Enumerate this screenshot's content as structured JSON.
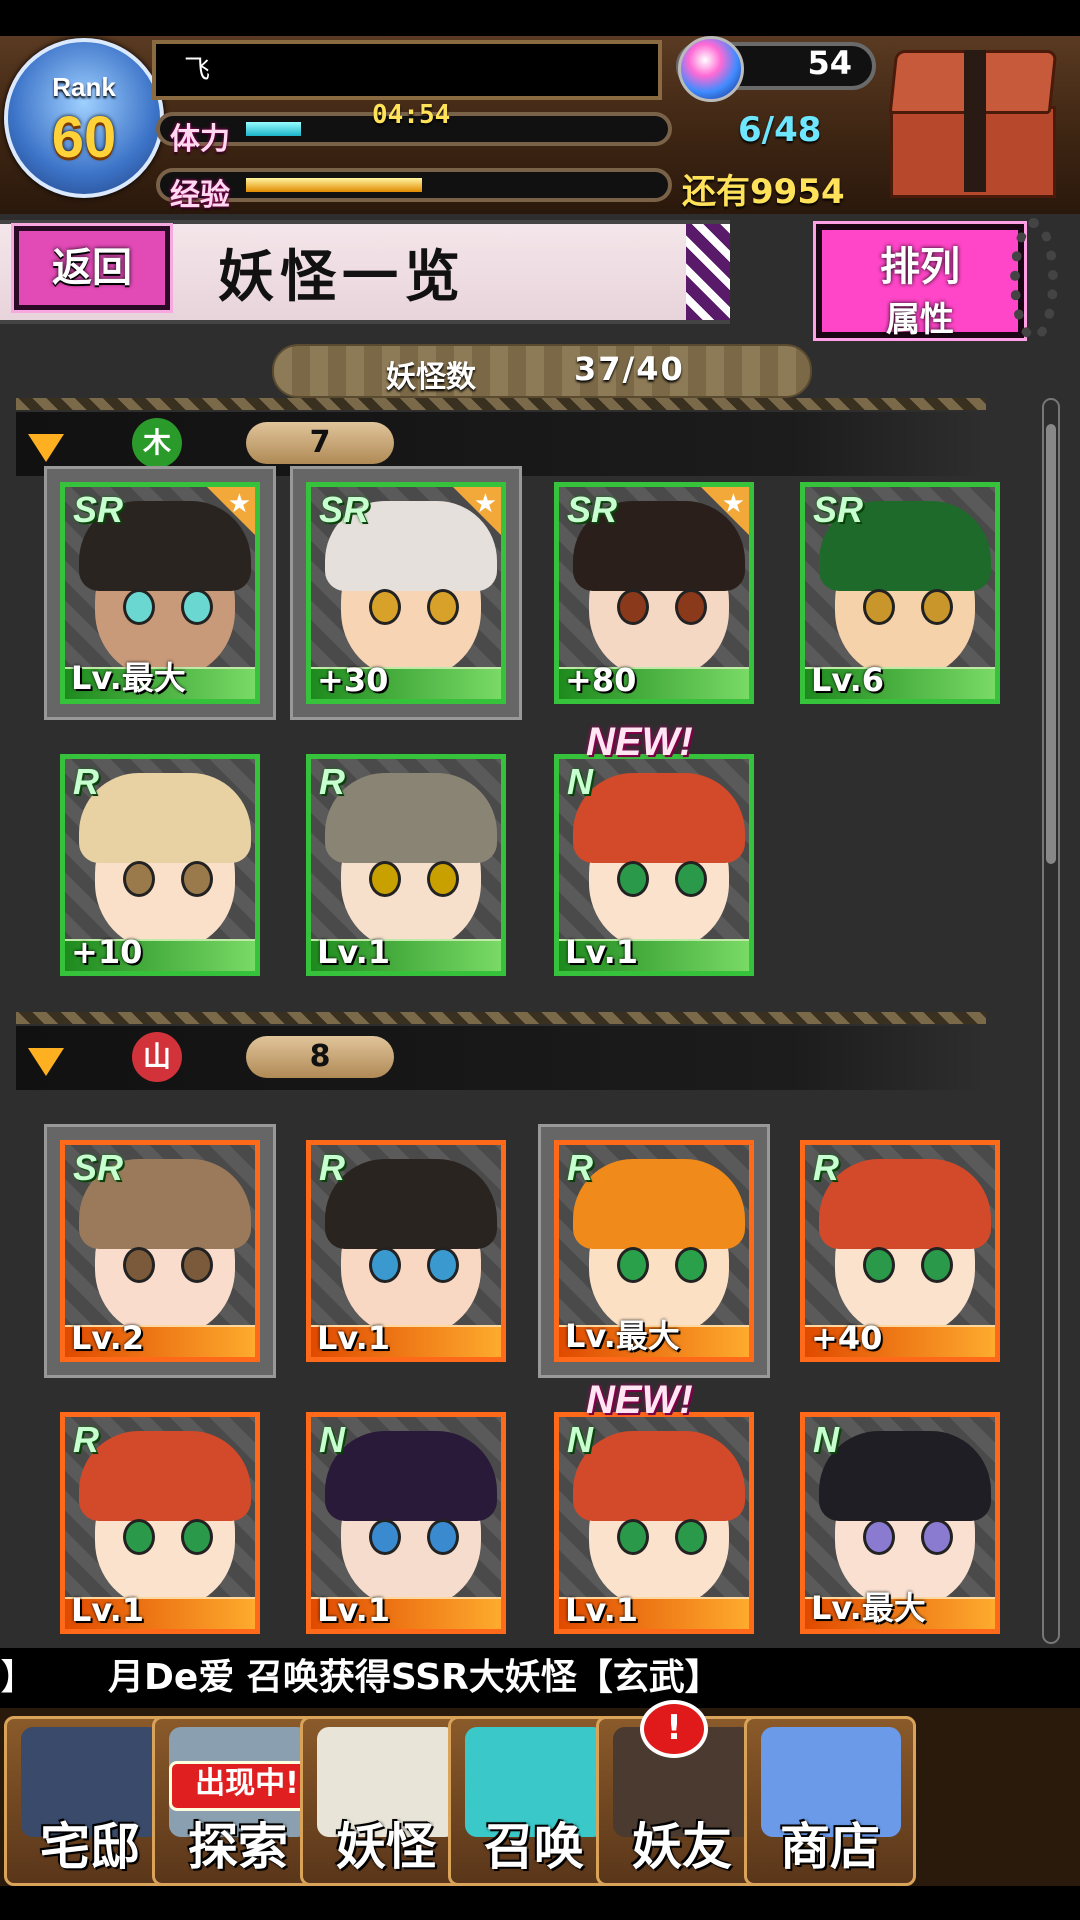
{
  "status": {
    "rank_label": "Rank",
    "rank_value": "60",
    "player_name": "飞",
    "stamina_label": "体力",
    "stamina_timer": "04:54",
    "stamina_fill": 0.13,
    "stamina_count": "6/48",
    "exp_label": "经验",
    "exp_fill": 0.42,
    "exp_remaining": "还有9954",
    "gems": "54"
  },
  "page": {
    "back_label": "返回",
    "title": "妖怪一览",
    "sort_line1": "排列",
    "sort_line2": "属性",
    "count_label": "妖怪数",
    "count_value": "37/40"
  },
  "sections": [
    {
      "element_glyph": "木",
      "element_color": "#2a9a2a",
      "count": "7",
      "cards": [
        {
          "rarity": "SR",
          "level": "Lv.最大",
          "starred": true,
          "selected": true,
          "new": false,
          "hair": "#2a2420",
          "skin": "#c89a7a",
          "eye": "#6ad7d0"
        },
        {
          "rarity": "SR",
          "level": "+30",
          "starred": true,
          "selected": true,
          "new": false,
          "hair": "#e6e0dc",
          "skin": "#f7d4b4",
          "eye": "#d8a22a"
        },
        {
          "rarity": "SR",
          "level": "+80",
          "starred": true,
          "selected": false,
          "new": false,
          "hair": "#2a1f1a",
          "skin": "#f5d8c4",
          "eye": "#8a3a1a"
        },
        {
          "rarity": "SR",
          "level": "Lv.6",
          "starred": false,
          "selected": false,
          "new": false,
          "hair": "#1e6a2a",
          "skin": "#f6d2aa",
          "eye": "#c8962a"
        },
        {
          "rarity": "R",
          "level": "+10",
          "starred": false,
          "selected": false,
          "new": false,
          "hair": "#e8d2a4",
          "skin": "#fae0c8",
          "eye": "#9a7a4a"
        },
        {
          "rarity": "R",
          "level": "Lv.1",
          "starred": false,
          "selected": false,
          "new": false,
          "hair": "#8a8474",
          "skin": "#f6e0cc",
          "eye": "#c8a000"
        },
        {
          "rarity": "N",
          "level": "Lv.1",
          "starred": false,
          "selected": false,
          "new": true,
          "hair": "#d24a2a",
          "skin": "#fbe2cc",
          "eye": "#2a9a4a"
        }
      ]
    },
    {
      "element_glyph": "山",
      "element_color": "#d2323a",
      "count": "8",
      "cards": [
        {
          "rarity": "SR",
          "level": "Lv.2",
          "starred": false,
          "selected": true,
          "new": false,
          "hair": "#9a7a5a",
          "skin": "#fadccc",
          "eye": "#7a5a3a"
        },
        {
          "rarity": "R",
          "level": "Lv.1",
          "starred": false,
          "selected": false,
          "new": false,
          "hair": "#2a2420",
          "skin": "#f8d8c2",
          "eye": "#3a9ad0"
        },
        {
          "rarity": "R",
          "level": "Lv.最大",
          "starred": false,
          "selected": true,
          "new": false,
          "hair": "#f08a1a",
          "skin": "#fbe0c4",
          "eye": "#2aa04a"
        },
        {
          "rarity": "R",
          "level": "+40",
          "starred": false,
          "selected": false,
          "new": false,
          "hair": "#d24a2a",
          "skin": "#fbe2cc",
          "eye": "#2a9a4a"
        },
        {
          "rarity": "R",
          "level": "Lv.1",
          "starred": false,
          "selected": false,
          "new": false,
          "hair": "#d24a2a",
          "skin": "#fbe2cc",
          "eye": "#2a9a4a"
        },
        {
          "rarity": "N",
          "level": "Lv.1",
          "starred": false,
          "selected": false,
          "new": false,
          "hair": "#2a1a3a",
          "skin": "#f6dccc",
          "eye": "#3a8ad0"
        },
        {
          "rarity": "N",
          "level": "Lv.1",
          "starred": false,
          "selected": false,
          "new": true,
          "hair": "#d24a2a",
          "skin": "#fbe2cc",
          "eye": "#2a9a4a"
        },
        {
          "rarity": "N",
          "level": "Lv.最大",
          "starred": false,
          "selected": false,
          "new": false,
          "hair": "#1e1e24",
          "skin": "#fae0d0",
          "eye": "#8a7ad0"
        }
      ]
    }
  ],
  "new_label": "NEW!",
  "ticker": "月De爱 召唤获得SSR大妖怪【玄武】",
  "ticker_left_bracket": "】",
  "nav": [
    {
      "label": "宅邸",
      "icon": "house-icon",
      "art": "#3a4a6a"
    },
    {
      "label": "探索",
      "icon": "explore-icon",
      "art": "#8aa0b0",
      "badge": "出现中!"
    },
    {
      "label": "妖怪",
      "icon": "scroll-icon",
      "art": "#e8e4d8"
    },
    {
      "label": "召唤",
      "icon": "pentagram-icon",
      "art": "#3ac8c8"
    },
    {
      "label": "妖友",
      "icon": "friend-icon",
      "art": "#4a3a30"
    },
    {
      "label": "商店",
      "icon": "orb-icon",
      "art": "#6a9ae8"
    }
  ],
  "summon_alert": "!"
}
